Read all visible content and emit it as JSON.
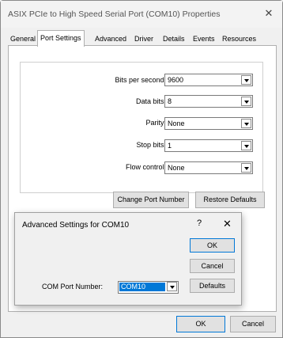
{
  "window": {
    "title": "ASIX PCIe to High Speed Serial Port (COM10) Properties",
    "close_glyph": "✕"
  },
  "tabs": [
    {
      "label": "General"
    },
    {
      "label": "Port Settings"
    },
    {
      "label": "Advanced"
    },
    {
      "label": "Driver"
    },
    {
      "label": "Details"
    },
    {
      "label": "Events"
    },
    {
      "label": "Resources"
    }
  ],
  "port_settings": {
    "rows": [
      {
        "label": "Bits per second:",
        "value": "9600"
      },
      {
        "label": "Data bits:",
        "value": "8"
      },
      {
        "label": "Parity:",
        "value": "None"
      },
      {
        "label": "Stop bits:",
        "value": "1"
      },
      {
        "label": "Flow control:",
        "value": "None"
      }
    ],
    "change_port_label": "Change Port Number",
    "restore_defaults_label": "Restore Defaults"
  },
  "footer": {
    "ok_label": "OK",
    "cancel_label": "Cancel"
  },
  "advanced_dialog": {
    "title": "Advanced Settings for COM10",
    "help_glyph": "?",
    "close_glyph": "✕",
    "ok_label": "OK",
    "cancel_label": "Cancel",
    "defaults_label": "Defaults",
    "com_port_label": "COM Port Number:",
    "com_port_value": "COM10"
  },
  "colors": {
    "accent": "#0078d7",
    "window_bg": "#f0f0f0",
    "panel_bg": "#ffffff"
  }
}
